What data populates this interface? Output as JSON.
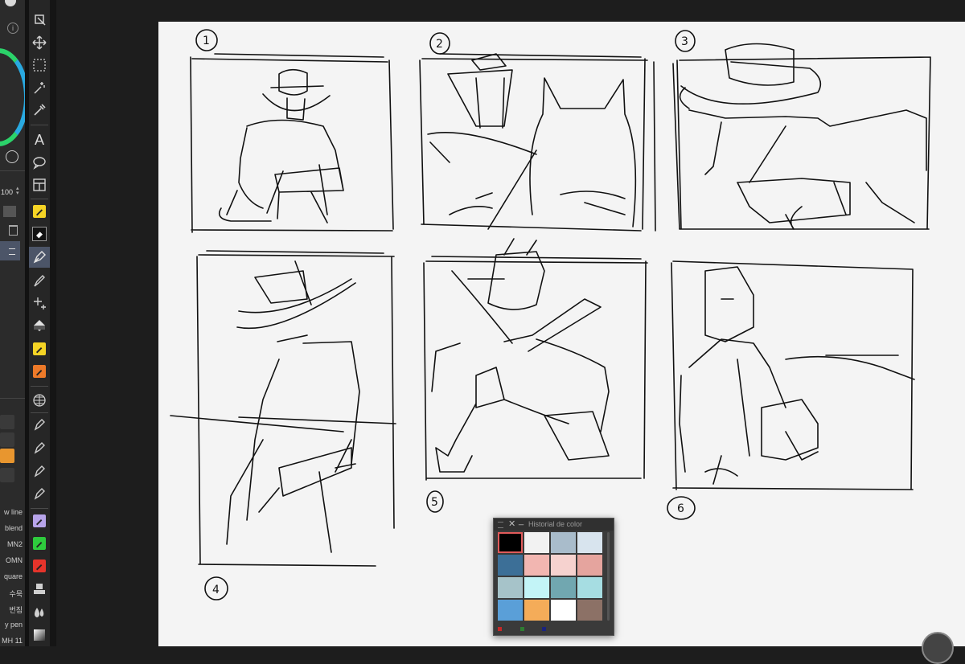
{
  "left_panel": {
    "opacity_value": "100",
    "brush_names": [
      "w line",
      "blend",
      "MN2",
      "OMN",
      "quare",
      "수묵",
      "번짐",
      "y pen",
      "MH 11"
    ]
  },
  "toolbar": {
    "tools": [
      {
        "name": "object-tool"
      },
      {
        "name": "move-tool"
      },
      {
        "name": "selection-tool"
      },
      {
        "name": "magic-wand-tool"
      },
      {
        "name": "eyedropper-tool"
      },
      {
        "name": "text-tool",
        "label": "A"
      },
      {
        "name": "lasso-tool"
      },
      {
        "name": "frame-tool"
      },
      {
        "name": "pencil-tool"
      },
      {
        "name": "eraser-tool"
      },
      {
        "name": "pen-tool"
      },
      {
        "name": "brush-tool"
      },
      {
        "name": "sparkle-tool"
      },
      {
        "name": "fill-tool"
      },
      {
        "name": "marker-tool"
      },
      {
        "name": "marker2-tool"
      },
      {
        "name": "grid-tool"
      },
      {
        "name": "pen2-tool"
      },
      {
        "name": "pen3-tool"
      },
      {
        "name": "pen4-tool"
      },
      {
        "name": "pen5-tool"
      },
      {
        "name": "purple-brush-tool"
      },
      {
        "name": "green-brush-tool"
      },
      {
        "name": "red-brush-tool"
      },
      {
        "name": "stamp-tool"
      },
      {
        "name": "blend-tool"
      },
      {
        "name": "gradient-tool"
      }
    ]
  },
  "canvas": {
    "panel_numbers": [
      "1",
      "2",
      "3",
      "4",
      "5",
      "6"
    ]
  },
  "color_history": {
    "title": "Historial de color",
    "swatches": [
      "#000000",
      "#f2f2f2",
      "#a9bccb",
      "#d8e4ee",
      "#3c6f97",
      "#f2b6b1",
      "#f6d2cf",
      "#e5a49e",
      "#a6c3c9",
      "#c3f4f7",
      "#71a7b0",
      "#a6dde2",
      "#5a9fd8",
      "#f4ac59",
      "#ffffff",
      "#8c7166"
    ],
    "footer_colors": [
      "#c62828",
      "#2e7d32",
      "#1a237e"
    ]
  }
}
